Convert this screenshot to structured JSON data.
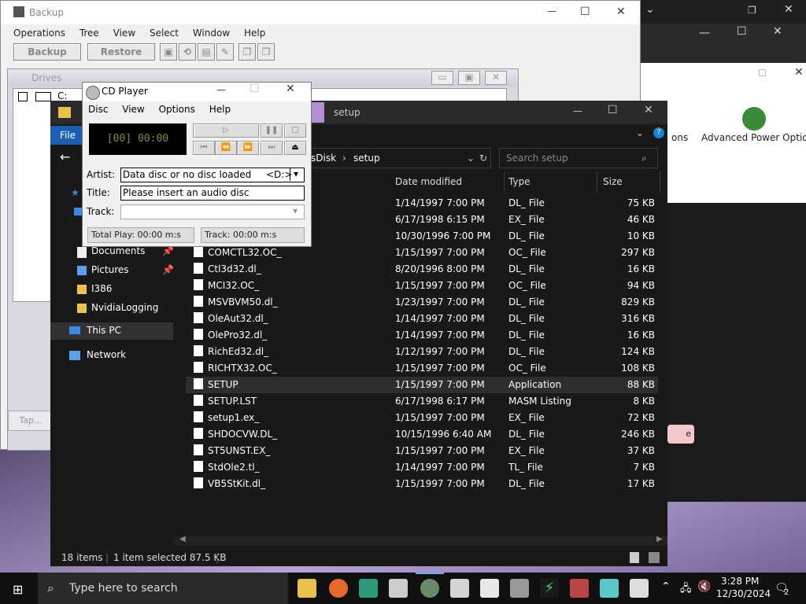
{
  "backup": {
    "title": "Backup",
    "menu": [
      "Operations",
      "Tree",
      "View",
      "Select",
      "Window",
      "Help"
    ],
    "btn_backup": "Backup",
    "btn_restore": "Restore",
    "drives_title": "Drives",
    "drive_c": "C:",
    "tape_label": "Tap..."
  },
  "power": {
    "item1": "ons",
    "item2": "Advanced Power Options"
  },
  "cd": {
    "title": "CD Player",
    "menu": [
      "Disc",
      "View",
      "Options",
      "Help"
    ],
    "display": "[00] 00:00",
    "artist_label": "Artist:",
    "artist_value": "Data disc or no disc loaded",
    "drive_value": "<D:>",
    "title_label": "Title:",
    "title_value": "Please insert an audio disc",
    "track_label": "Track:",
    "total_play": "Total Play: 00:00 m:s",
    "track_time": "Track: 00:00 m:s"
  },
  "explorer": {
    "title": "setup",
    "ribbon_file": "File",
    "addr_parent": "sDisk",
    "addr_current": "setup",
    "search_placeholder": "Search setup",
    "cols": {
      "date": "Date modified",
      "type": "Type",
      "size": "Size"
    },
    "nav": [
      "Documents",
      "Pictures",
      "I386",
      "NvidiaLogging",
      "This PC",
      "Network"
    ],
    "files": [
      {
        "name": "",
        "date": "1/14/1997 7:00 PM",
        "type": "DL_ File",
        "size": "75 KB"
      },
      {
        "name": "",
        "date": "6/17/1998 6:15 PM",
        "type": "EX_ File",
        "size": "46 KB"
      },
      {
        "name": "",
        "date": "10/30/1996 7:00 PM",
        "type": "DL_ File",
        "size": "10 KB"
      },
      {
        "name": "COMCTL32.OC_",
        "date": "1/15/1997 7:00 PM",
        "type": "OC_ File",
        "size": "297 KB"
      },
      {
        "name": "Ctl3d32.dl_",
        "date": "8/20/1996 8:00 PM",
        "type": "DL_ File",
        "size": "16 KB"
      },
      {
        "name": "MCI32.OC_",
        "date": "1/15/1997 7:00 PM",
        "type": "OC_ File",
        "size": "94 KB"
      },
      {
        "name": "MSVBVM50.dl_",
        "date": "1/23/1997 7:00 PM",
        "type": "DL_ File",
        "size": "829 KB"
      },
      {
        "name": "OleAut32.dl_",
        "date": "1/14/1997 7:00 PM",
        "type": "DL_ File",
        "size": "316 KB"
      },
      {
        "name": "OlePro32.dl_",
        "date": "1/14/1997 7:00 PM",
        "type": "DL_ File",
        "size": "16 KB"
      },
      {
        "name": "RichEd32.dl_",
        "date": "1/12/1997 7:00 PM",
        "type": "DL_ File",
        "size": "124 KB"
      },
      {
        "name": "RICHTX32.OC_",
        "date": "1/15/1997 7:00 PM",
        "type": "OC_ File",
        "size": "108 KB"
      },
      {
        "name": "SETUP",
        "date": "1/15/1997 7:00 PM",
        "type": "Application",
        "size": "88 KB"
      },
      {
        "name": "SETUP.LST",
        "date": "6/17/1998 6:17 PM",
        "type": "MASM Listing",
        "size": "8 KB"
      },
      {
        "name": "setup1.ex_",
        "date": "1/15/1997 7:00 PM",
        "type": "EX_ File",
        "size": "72 KB"
      },
      {
        "name": "SHDOCVW.DL_",
        "date": "10/15/1996 6:40 AM",
        "type": "DL_ File",
        "size": "246 KB"
      },
      {
        "name": "ST5UNST.EX_",
        "date": "1/15/1997 7:00 PM",
        "type": "EX_ File",
        "size": "37 KB"
      },
      {
        "name": "StdOle2.tl_",
        "date": "1/14/1997 7:00 PM",
        "type": "TL_ File",
        "size": "7 KB"
      },
      {
        "name": "VB5StKit.dl_",
        "date": "1/15/1997 7:00 PM",
        "type": "DL_ File",
        "size": "17 KB"
      }
    ],
    "status_items": "18 items",
    "status_selected": "1 item selected  87.5 KB"
  },
  "taskbar": {
    "search_placeholder": "Type here to search",
    "time": "3:28 PM",
    "date": "12/30/2024",
    "notif_count": "2"
  }
}
